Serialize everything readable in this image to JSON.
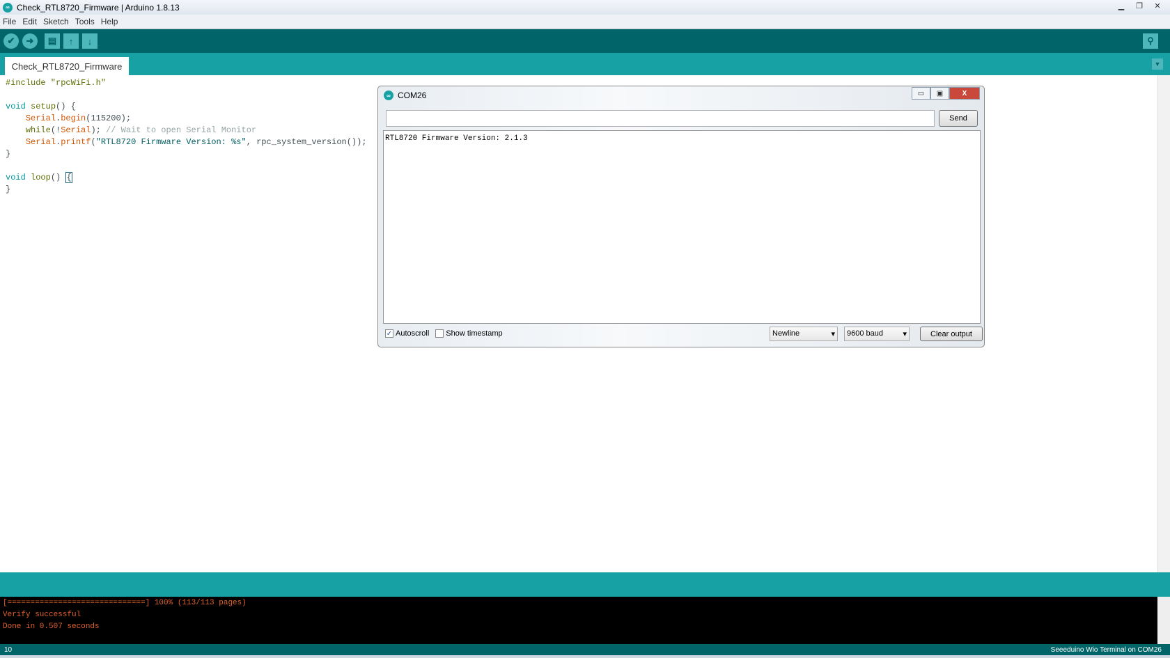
{
  "window": {
    "title": "Check_RTL8720_Firmware | Arduino 1.8.13"
  },
  "menu": [
    "File",
    "Edit",
    "Sketch",
    "Tools",
    "Help"
  ],
  "toolbar": {
    "verify": "verify-icon",
    "upload": "upload-icon",
    "new": "new-icon",
    "open": "open-icon",
    "save": "save-icon",
    "serial_monitor": "serial-monitor-icon"
  },
  "tab": {
    "label": "Check_RTL8720_Firmware"
  },
  "code": {
    "l1": "#include \"rpcWiFi.h\"",
    "l3a": "void",
    "l3b": "setup",
    "l3c": "() {",
    "l4a": "Serial",
    "l4b": ".",
    "l4c": "begin",
    "l4d": "(115200);",
    "l5a": "while",
    "l5b": "(!",
    "l5c": "Serial",
    "l5d": "); ",
    "l5e": "// Wait to open Serial Monitor",
    "l6a": "Serial",
    "l6b": ".",
    "l6c": "printf",
    "l6d": "(",
    "l6e": "\"RTL8720 Firmware Version: %s\"",
    "l6f": ", rpc_system_version());",
    "l7": "}",
    "l9a": "void",
    "l9b": "loop",
    "l9c": "() ",
    "l9d": "{",
    "l10": "}"
  },
  "console": [
    "[==============================] 100% (113/113 pages)",
    "Verify successful",
    "Done in 0.507 seconds"
  ],
  "status": {
    "line": "10",
    "board": "Seeeduino Wio Terminal on COM26"
  },
  "serial": {
    "title": "COM26",
    "input_value": "",
    "send": "Send",
    "output": "RTL8720 Firmware Version: 2.1.3",
    "autoscroll": "Autoscroll",
    "autoscroll_checked": true,
    "timestamp": "Show timestamp",
    "timestamp_checked": false,
    "line_ending": "Newline",
    "baud": "9600 baud",
    "clear": "Clear output"
  }
}
